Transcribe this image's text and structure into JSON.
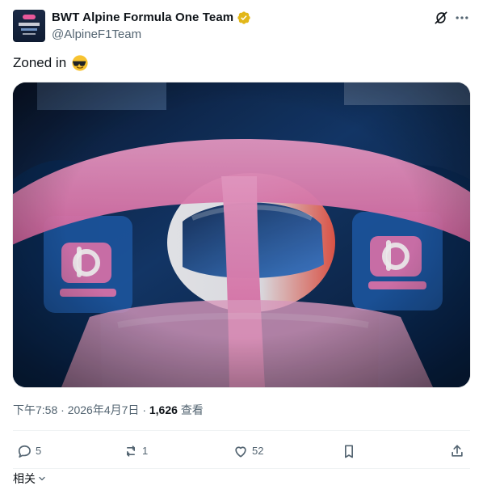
{
  "tweet": {
    "author": {
      "display_name": "BWT Alpine Formula One Team",
      "handle": "@AlpineF1Team",
      "verified_badge_color": "#e2b719",
      "avatar_icon": "alpine-logo-avatar"
    },
    "text": "Zoned in",
    "text_emoji": "smiling-face-with-sunglasses",
    "media": {
      "alt": "Driver in a pink Alpine F1 car cockpit framed by the halo, BWT logos on both sidepods",
      "logo_left": "BWT",
      "logo_right": "BWT",
      "colors": {
        "pink": "#e87ab4",
        "blue": "#1f5aa6",
        "dark": "#0b1730"
      }
    },
    "meta": {
      "time": "下午7:58",
      "separator": "·",
      "date": "2026年4月7日",
      "separator2": "·",
      "views_count": "1,626",
      "views_label": "查看"
    },
    "actions": {
      "replies": "5",
      "reposts": "1",
      "likes": "52"
    },
    "related_label": "相关"
  }
}
